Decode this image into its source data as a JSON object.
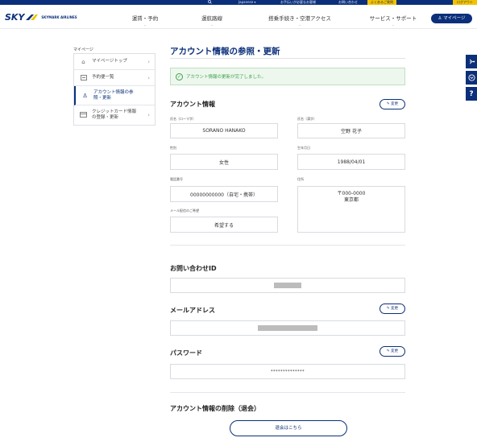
{
  "utility_bar": {
    "search_icon": "search-icon",
    "language": "Japanese ▾",
    "link_help": "お手伝いが必要なお客様",
    "link_inquiry": "お問い合わせ",
    "link_faq": "よくあるご質問",
    "login": "ログアウト"
  },
  "header": {
    "logo_text": "SKY",
    "logo_sub": "SKYMARK AIRLINES",
    "nav": [
      {
        "label": "運賃・予約"
      },
      {
        "label": "運航路線"
      },
      {
        "label": "搭乗手続き・空港アクセス"
      },
      {
        "label": "サービス・サポート"
      }
    ],
    "mypage_button": "♙ マイページ"
  },
  "floating_tools": [
    {
      "icon": "airplane-icon"
    },
    {
      "icon": "chevron-icon"
    },
    {
      "icon": "help-icon",
      "label": "?"
    }
  ],
  "sidebar": {
    "title": "マイページ",
    "items": [
      {
        "label": "マイページトップ",
        "icon": "home-icon"
      },
      {
        "label": "予約便一覧",
        "icon": "ticket-icon"
      },
      {
        "label": "アカウント情報の参照・更新",
        "icon": "user-icon",
        "active": true
      },
      {
        "label": "クレジットカード情報の登録・更新",
        "icon": "card-icon"
      }
    ]
  },
  "main": {
    "title": "アカウント情報の参照・更新",
    "notice": "アカウント情報の更新が完了しました。",
    "account_section": {
      "title": "アカウント情報",
      "edit_label": "✎ 変更",
      "fields": {
        "name_roman_label": "氏名（ローマ字）",
        "name_roman": "SORANO HANAKO",
        "name_kanji_label": "氏名（漢字）",
        "name_kanji": "空野 花子",
        "gender_label": "性別",
        "gender": "女性",
        "birthdate_label": "生年月日",
        "birthdate": "1988/04/01",
        "phone_label": "電話番号",
        "phone": "00000000000（自宅・携帯）",
        "address_label": "住所",
        "address_line1": "〒000-0000",
        "address_line2": "東京都",
        "email_pref_label": "メール配信のご希望",
        "email_pref": "希望する"
      }
    },
    "inquiry_section": {
      "title": "お問い合わせID"
    },
    "email_section": {
      "title": "メールアドレス",
      "edit_label": "✎ 変更"
    },
    "password_section": {
      "title": "パスワード",
      "edit_label": "✎ 変更",
      "value": "**************"
    },
    "delete_section": {
      "title": "アカウント情報の削除（退会）",
      "button": "退会はこちら"
    }
  }
}
